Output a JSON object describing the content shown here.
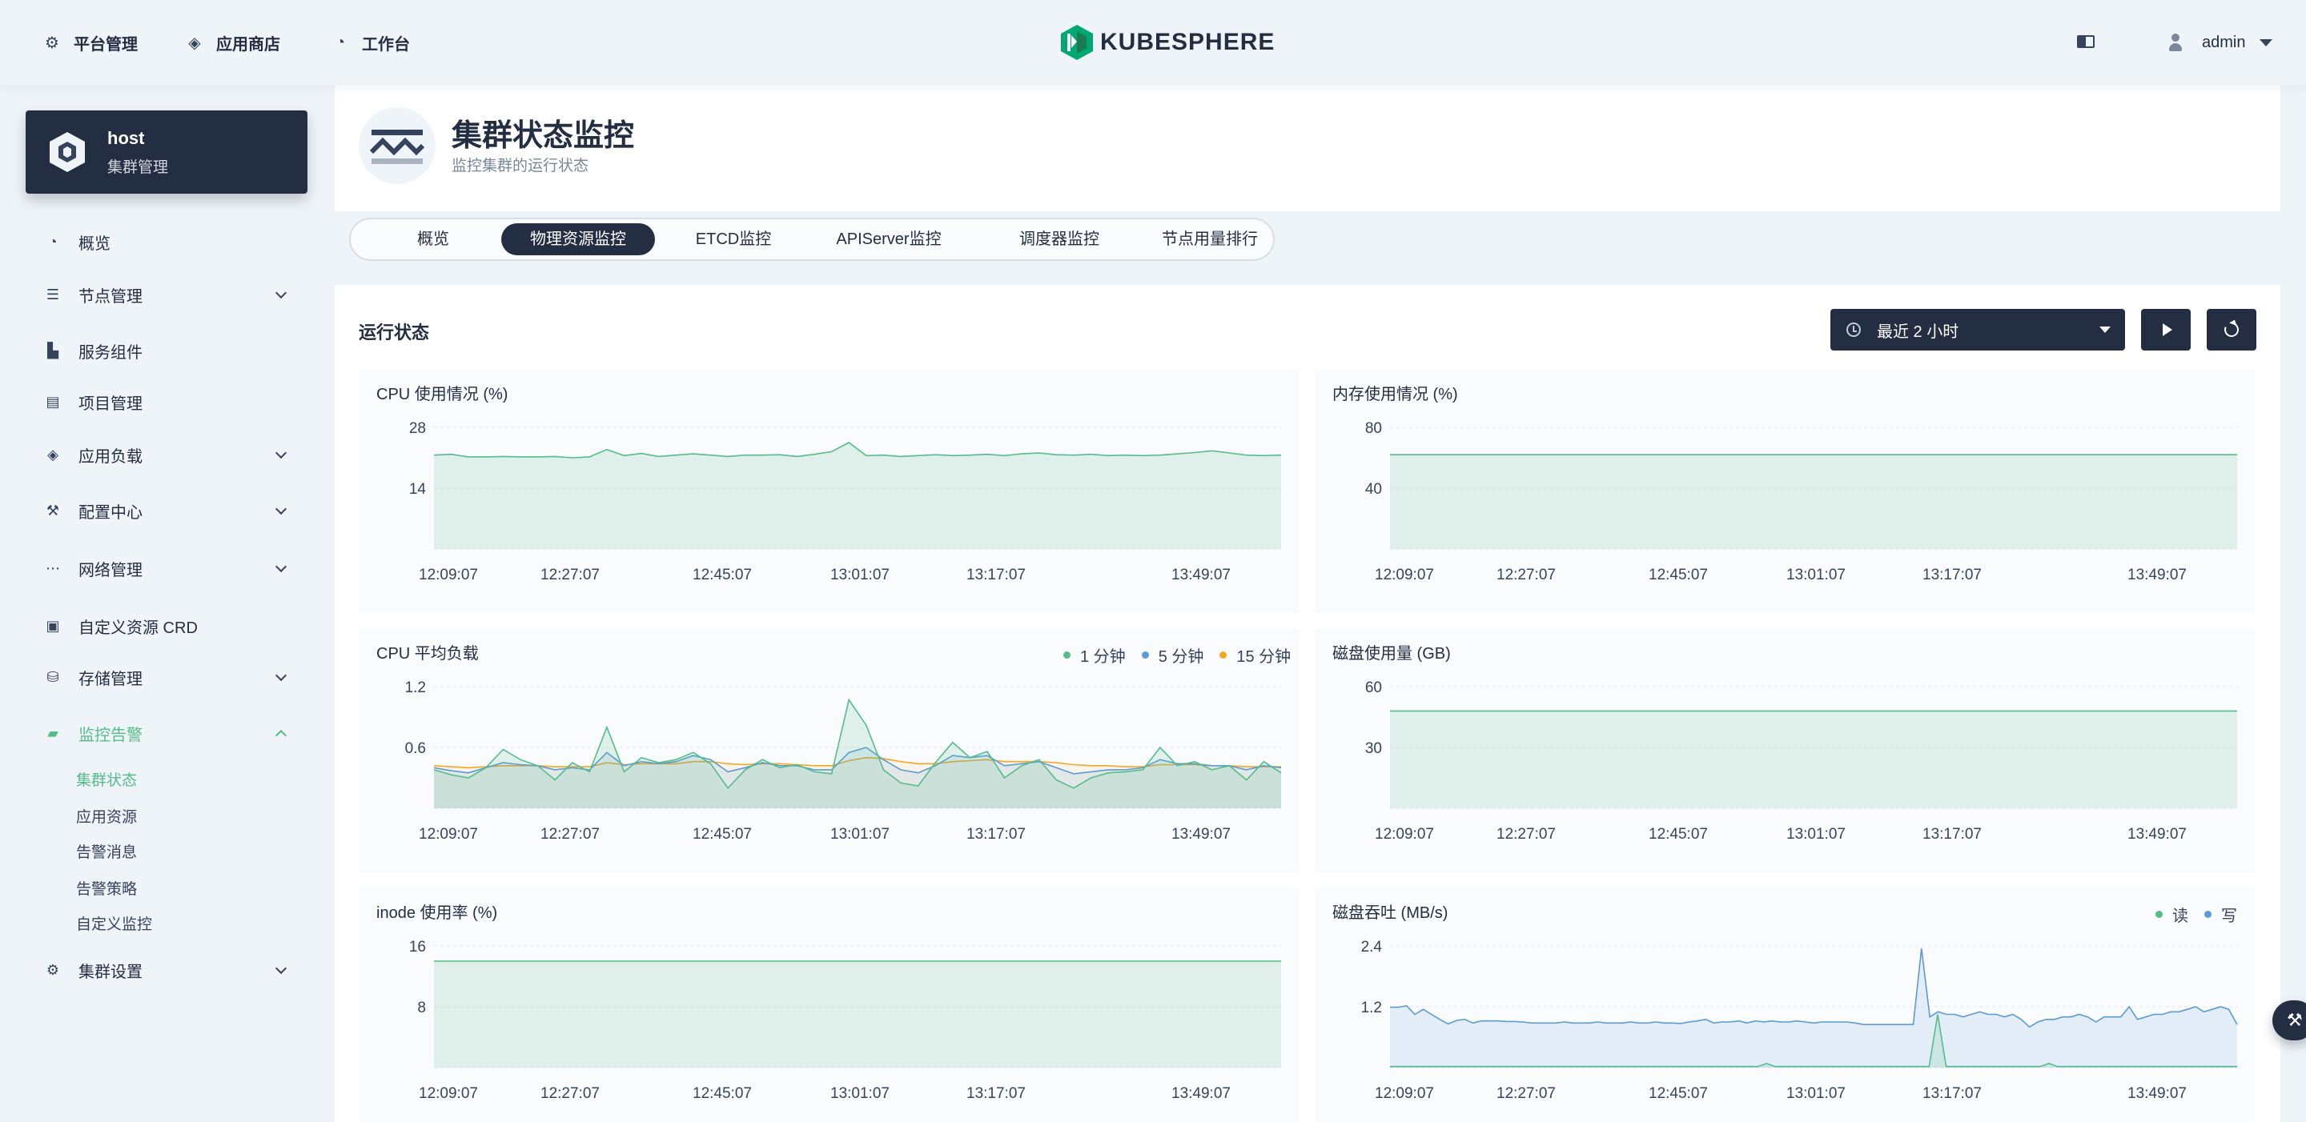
{
  "topnav": [
    {
      "label": "平台管理",
      "icon": "gear-icon"
    },
    {
      "label": "应用商店",
      "icon": "layers-icon"
    },
    {
      "label": "工作台",
      "icon": "dashboard-icon"
    }
  ],
  "brand": {
    "name": "KUBESPHERE",
    "color": "#00a971"
  },
  "user": {
    "name": "admin"
  },
  "cluster": {
    "name": "host",
    "subtitle": "集群管理"
  },
  "sidebar": {
    "items": [
      {
        "label": "概览",
        "icon": "dashboard-icon",
        "expandable": false
      },
      {
        "label": "节点管理",
        "icon": "server-icon",
        "expandable": true
      },
      {
        "label": "服务组件",
        "icon": "components-icon",
        "expandable": false
      },
      {
        "label": "项目管理",
        "icon": "project-icon",
        "expandable": false
      },
      {
        "label": "应用负载",
        "icon": "layers-icon",
        "expandable": true
      },
      {
        "label": "配置中心",
        "icon": "hammer-icon",
        "expandable": true
      },
      {
        "label": "网络管理",
        "icon": "network-icon",
        "expandable": true
      },
      {
        "label": "自定义资源 CRD",
        "icon": "crd-icon",
        "expandable": false
      },
      {
        "label": "存储管理",
        "icon": "database-icon",
        "expandable": true
      },
      {
        "label": "监控告警",
        "icon": "monitor-icon",
        "expandable": true,
        "active": true
      },
      {
        "label": "集群设置",
        "icon": "gear-icon",
        "expandable": true
      }
    ],
    "monitoring_sub": [
      "集群状态",
      "应用资源",
      "告警消息",
      "告警策略",
      "自定义监控"
    ]
  },
  "page": {
    "title": "集群状态监控",
    "description": "监控集群的运行状态"
  },
  "tabs": [
    "概览",
    "物理资源监控",
    "ETCD监控",
    "APIServer监控",
    "调度器监控",
    "节点用量排行"
  ],
  "active_tab": 1,
  "panel": {
    "title": "运行状态",
    "time_range": "最近 2 小时"
  },
  "colors": {
    "green": "#55bc8a",
    "blue": "#5b9bd5",
    "orange": "#f5a623",
    "dark": "#242e42",
    "accent": "#55bc8a"
  },
  "chart_data": [
    {
      "type": "area",
      "title": "CPU 使用情况 (%)",
      "yticks": [
        "28",
        "14"
      ],
      "ylim": [
        0,
        28
      ],
      "xticks": [
        "12:09:07",
        "12:27:07",
        "12:45:07",
        "13:01:07",
        "13:17:07",
        "13:49:07"
      ],
      "series": [
        {
          "color": "#55bc8a",
          "values": [
            21.6,
            21.8,
            21.2,
            21.2,
            21.3,
            21.2,
            21.2,
            21.3,
            21.0,
            21.2,
            22.9,
            21.5,
            22.0,
            21.3,
            21.6,
            21.9,
            21.6,
            21.3,
            21.6,
            21.6,
            21.7,
            21.3,
            21.8,
            22.4,
            24.5,
            21.5,
            21.6,
            21.3,
            21.5,
            21.7,
            21.5,
            21.6,
            21.8,
            21.5,
            21.9,
            22.1,
            21.7,
            21.6,
            21.8,
            21.5,
            21.6,
            21.5,
            21.6,
            21.9,
            22.2,
            22.6,
            22.1,
            21.6,
            21.5,
            21.6
          ]
        }
      ]
    },
    {
      "type": "area",
      "title": "内存使用情况 (%)",
      "yticks": [
        "80",
        "40"
      ],
      "ylim": [
        0,
        80
      ],
      "xticks": [
        "12:09:07",
        "12:27:07",
        "12:45:07",
        "13:01:07",
        "13:17:07",
        "13:49:07"
      ],
      "series": [
        {
          "color": "#55bc8a",
          "values": [
            62,
            62,
            62,
            62,
            62,
            62,
            62,
            62,
            62,
            62,
            62,
            62,
            62,
            62,
            62,
            62,
            62,
            62,
            62,
            62
          ]
        }
      ]
    },
    {
      "type": "line",
      "title": "CPU 平均负载",
      "yticks": [
        "1.2",
        "0.6"
      ],
      "ylim": [
        0,
        1.2
      ],
      "xticks": [
        "12:09:07",
        "12:27:07",
        "12:45:07",
        "13:01:07",
        "13:17:07",
        "13:49:07"
      ],
      "legend": [
        {
          "name": "1 分钟",
          "color": "#55bc8a"
        },
        {
          "name": "5 分钟",
          "color": "#5b9bd5"
        },
        {
          "name": "15 分钟",
          "color": "#f5a623"
        }
      ],
      "series": [
        {
          "name": "1 分钟",
          "color": "#55bc8a",
          "values": [
            0.38,
            0.33,
            0.3,
            0.4,
            0.58,
            0.48,
            0.42,
            0.28,
            0.45,
            0.36,
            0.8,
            0.36,
            0.5,
            0.45,
            0.48,
            0.55,
            0.44,
            0.2,
            0.38,
            0.48,
            0.4,
            0.43,
            0.36,
            0.34,
            1.07,
            0.82,
            0.38,
            0.25,
            0.22,
            0.45,
            0.65,
            0.5,
            0.56,
            0.3,
            0.42,
            0.48,
            0.28,
            0.2,
            0.3,
            0.35,
            0.36,
            0.38,
            0.6,
            0.42,
            0.46,
            0.38,
            0.42,
            0.28,
            0.46,
            0.35
          ]
        },
        {
          "name": "5 分钟",
          "color": "#5b9bd5",
          "values": [
            0.4,
            0.37,
            0.35,
            0.4,
            0.45,
            0.43,
            0.42,
            0.38,
            0.4,
            0.38,
            0.55,
            0.42,
            0.46,
            0.44,
            0.46,
            0.52,
            0.48,
            0.36,
            0.4,
            0.45,
            0.42,
            0.42,
            0.38,
            0.38,
            0.55,
            0.6,
            0.48,
            0.38,
            0.35,
            0.42,
            0.52,
            0.5,
            0.52,
            0.42,
            0.44,
            0.46,
            0.4,
            0.34,
            0.36,
            0.38,
            0.38,
            0.4,
            0.48,
            0.44,
            0.44,
            0.42,
            0.42,
            0.38,
            0.42,
            0.4
          ]
        },
        {
          "name": "15 分钟",
          "color": "#f5a623",
          "values": [
            0.42,
            0.41,
            0.4,
            0.41,
            0.42,
            0.42,
            0.42,
            0.41,
            0.41,
            0.41,
            0.45,
            0.43,
            0.44,
            0.44,
            0.44,
            0.46,
            0.46,
            0.44,
            0.43,
            0.44,
            0.44,
            0.43,
            0.42,
            0.42,
            0.47,
            0.5,
            0.49,
            0.46,
            0.44,
            0.44,
            0.46,
            0.47,
            0.48,
            0.46,
            0.46,
            0.46,
            0.45,
            0.43,
            0.42,
            0.42,
            0.41,
            0.41,
            0.43,
            0.43,
            0.43,
            0.42,
            0.42,
            0.41,
            0.41,
            0.41
          ]
        }
      ]
    },
    {
      "type": "area",
      "title": "磁盘使用量 (GB)",
      "yticks": [
        "60",
        "30"
      ],
      "ylim": [
        0,
        60
      ],
      "xticks": [
        "12:09:07",
        "12:27:07",
        "12:45:07",
        "13:01:07",
        "13:17:07",
        "13:49:07"
      ],
      "series": [
        {
          "color": "#55bc8a",
          "values": [
            48,
            48,
            48,
            48,
            48,
            48,
            48,
            48,
            48,
            48,
            48,
            48,
            48,
            48,
            48,
            48,
            48,
            48,
            48,
            48
          ]
        }
      ]
    },
    {
      "type": "area",
      "title": "inode 使用率 (%)",
      "yticks": [
        "16",
        "8"
      ],
      "ylim": [
        0,
        16
      ],
      "xticks": [
        "12:09:07",
        "12:27:07",
        "12:45:07",
        "13:01:07",
        "13:17:07",
        "13:49:07"
      ],
      "series": [
        {
          "color": "#55bc8a",
          "values": [
            14,
            14,
            14,
            14,
            14,
            14,
            14,
            14,
            14,
            14,
            14,
            14,
            14,
            14,
            14,
            14,
            14,
            14,
            14,
            14
          ]
        }
      ]
    },
    {
      "type": "area",
      "title": "磁盘吞吐 (MB/s)",
      "yticks": [
        "2.4",
        "1.2"
      ],
      "ylim": [
        0,
        2.4
      ],
      "xticks": [
        "12:09:07",
        "12:27:07",
        "12:45:07",
        "13:01:07",
        "13:17:07",
        "13:49:07"
      ],
      "legend": [
        {
          "name": "读",
          "color": "#55bc8a"
        },
        {
          "name": "写",
          "color": "#5b9bd5"
        }
      ],
      "series": [
        {
          "name": "读",
          "color": "#55bc8a",
          "values": [
            0.02,
            0.02,
            0.02,
            0.02,
            0.02,
            0.02,
            0.02,
            0.02,
            0.02,
            0.02,
            0.02,
            0.02,
            0.02,
            0.02,
            0.02,
            0.02,
            0.02,
            0.02,
            0.02,
            0.02,
            0.02,
            0.02,
            0.02,
            0.02,
            0.02,
            0.02,
            0.02,
            0.02,
            0.02,
            0.02,
            0.02,
            0.02,
            0.02,
            0.02,
            0.02,
            0.02,
            0.02,
            0.02,
            0.02,
            0.02,
            0.02,
            0.02,
            0.02,
            0.02,
            0.08,
            0.02,
            0.02,
            0.02,
            0.02,
            0.02,
            0.02,
            0.02,
            0.02,
            0.02,
            0.02,
            0.02,
            0.02,
            0.02,
            0.02,
            0.02,
            0.02,
            0.02,
            0.02,
            0.02,
            1.05,
            0.02,
            0.02,
            0.02,
            0.02,
            0.02,
            0.02,
            0.02,
            0.02,
            0.02,
            0.02,
            0.02,
            0.02,
            0.08,
            0.02,
            0.02,
            0.02,
            0.02,
            0.02,
            0.02,
            0.02,
            0.02,
            0.02,
            0.02,
            0.02,
            0.02,
            0.02,
            0.02,
            0.02,
            0.02,
            0.02,
            0.02,
            0.02,
            0.02,
            0.02,
            0.02
          ]
        },
        {
          "name": "写",
          "color": "#5b9bd5",
          "values": [
            1.19,
            1.19,
            1.22,
            1.05,
            1.15,
            1.05,
            0.95,
            0.86,
            0.93,
            0.95,
            0.88,
            0.92,
            0.92,
            0.92,
            0.91,
            0.91,
            0.9,
            0.88,
            0.88,
            0.88,
            0.88,
            0.9,
            0.88,
            0.88,
            0.88,
            0.9,
            0.88,
            0.88,
            0.88,
            0.9,
            0.88,
            0.88,
            0.9,
            0.88,
            0.88,
            0.87,
            0.9,
            0.92,
            0.95,
            0.88,
            0.9,
            0.9,
            0.92,
            0.88,
            0.92,
            0.9,
            0.92,
            0.9,
            0.9,
            0.92,
            0.9,
            0.88,
            0.9,
            0.9,
            0.9,
            0.9,
            0.88,
            0.85,
            0.85,
            0.85,
            0.85,
            0.85,
            0.85,
            0.85,
            2.35,
            1.0,
            1.1,
            1.05,
            1.05,
            1.0,
            1.05,
            1.1,
            1.05,
            1.05,
            1.0,
            1.05,
            0.95,
            0.8,
            0.9,
            0.95,
            0.95,
            1.0,
            1.0,
            1.05,
            1.0,
            0.9,
            1.0,
            1.0,
            1.0,
            1.2,
            0.95,
            1.0,
            1.05,
            1.05,
            1.1,
            1.1,
            1.15,
            1.2,
            1.1,
            1.15,
            1.2,
            1.15,
            0.85
          ]
        }
      ]
    }
  ]
}
